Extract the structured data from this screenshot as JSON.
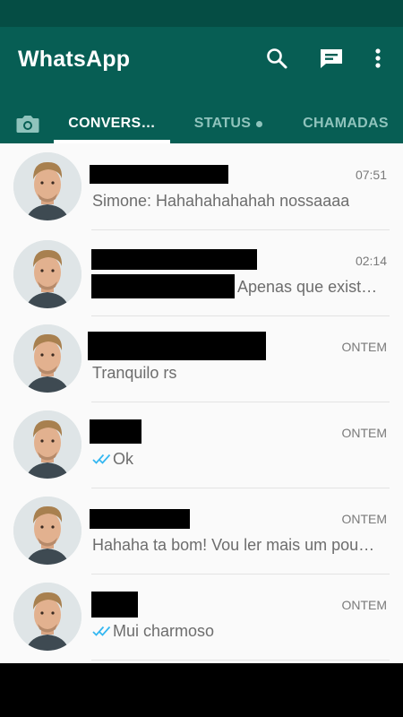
{
  "app": {
    "title": "WhatsApp"
  },
  "icons": {
    "search": "search-icon",
    "new_chat": "new-chat-icon",
    "more": "more-vert-icon",
    "camera": "camera-icon"
  },
  "tabs": [
    {
      "label": "CONVERS…",
      "active": true
    },
    {
      "label": "STATUS",
      "active": false
    },
    {
      "label": "CHAMADAS",
      "active": false
    }
  ],
  "chats": [
    {
      "time": "07:51",
      "preview": "Simone: Hahahahahahah nossaaaa",
      "read_ticks": false
    },
    {
      "time": "02:14",
      "preview": "Apenas que exist…",
      "read_ticks": false
    },
    {
      "time": "ONTEM",
      "preview": "Tranquilo rs",
      "read_ticks": false
    },
    {
      "time": "ONTEM",
      "preview": "Ok",
      "read_ticks": true
    },
    {
      "time": "ONTEM",
      "preview": "Hahaha ta bom! Vou ler mais um pou…",
      "read_ticks": false
    },
    {
      "time": "ONTEM",
      "preview": "Mui charmoso",
      "read_ticks": true
    }
  ],
  "colors": {
    "primary_dark": "#054d44",
    "primary": "#075e54",
    "tab_inactive": "#8fc3bc",
    "read_tick": "#34b7f1"
  }
}
